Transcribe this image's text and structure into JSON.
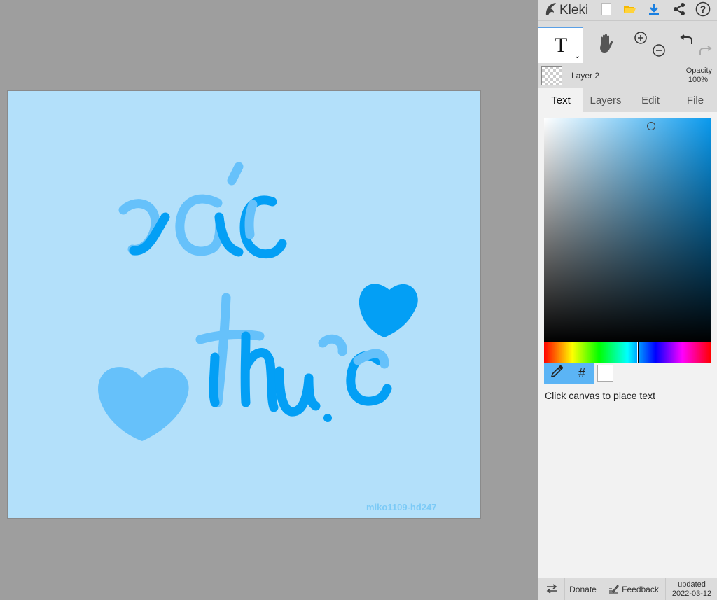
{
  "app": {
    "name": "Kleki"
  },
  "canvas": {
    "watermark": "miko1109-hd247",
    "background": "#b3e0fa"
  },
  "layer": {
    "name": "Layer 2",
    "opacity_label": "Opacity",
    "opacity_value": "100%"
  },
  "tabs": [
    {
      "label": "Text"
    },
    {
      "label": "Layers"
    },
    {
      "label": "Edit"
    },
    {
      "label": "File"
    }
  ],
  "tool": {
    "glyph": "T"
  },
  "color": {
    "primary": "#0a9aee",
    "secondary": "#ffffff",
    "hex_button": "#"
  },
  "hint": "Click canvas to place text",
  "footer": {
    "donate": "Donate",
    "feedback": "Feedback",
    "updated_label": "updated",
    "updated_date": "2022-03-12"
  },
  "icons": [
    "logo-icon",
    "new-image-icon",
    "open-folder-icon",
    "download-icon",
    "share-icon",
    "help-icon",
    "text-tool-icon",
    "hand-tool-icon",
    "zoom-in-icon",
    "zoom-out-icon",
    "undo-icon",
    "redo-icon",
    "eyedropper-icon",
    "swap-icon",
    "feedback-icon"
  ]
}
